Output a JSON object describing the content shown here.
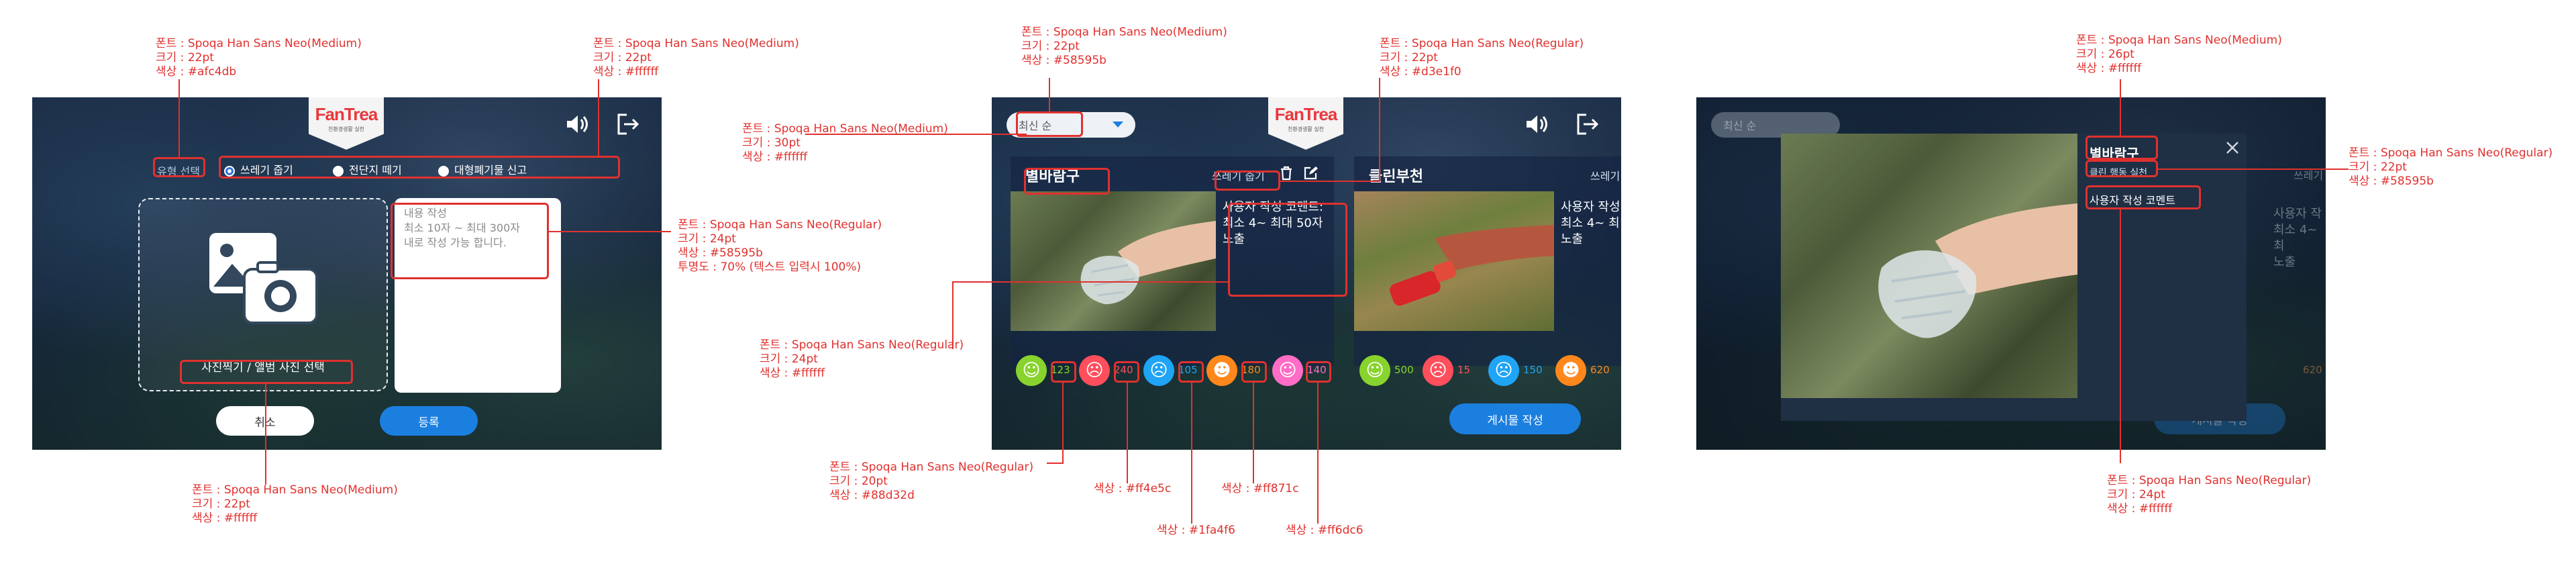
{
  "colors": {
    "annotation": "#e0312e",
    "type_select": "#afc4db",
    "white": "#ffffff",
    "placeholder": "#58595b",
    "gray_light": "#d3e1f0",
    "count_green": "#88d32d",
    "count_red": "#ff4e5c",
    "count_blue": "#1fa4f6",
    "count_orange": "#ff871c",
    "count_pink": "#ff6dc6",
    "submit_blue": "#1b7fe0"
  },
  "screen1": {
    "logo": "FanTrea",
    "logo_sub": "친환경생활 실천",
    "type_label": "유형 선택",
    "radios": [
      "쓰레기 줍기",
      "전단지 떼기",
      "대형폐기물 신고"
    ],
    "photo_label": "사진찍기 / 앨범 사진 선택",
    "textarea_lines": [
      "내용 작성",
      "최소 10자 ~ 최대 300자",
      "내로 작성 가능 합니다."
    ],
    "cancel": "취소",
    "submit": "등록",
    "icons": [
      "camera-gallery-icon",
      "speaker-icon",
      "logout-icon"
    ]
  },
  "screen2": {
    "sort_label": "최신 순",
    "card1": {
      "title": "별바람구",
      "category": "쓰레기 줍기",
      "comment": "사용자 작성 코멘트:\n최소 4~ 최대 50자\n노출",
      "counts": [
        "123",
        "240",
        "105",
        "180",
        "140"
      ]
    },
    "card2": {
      "title": "클린부천",
      "category": "쓰레기",
      "comment": "사용자 작성\n최소 4~ 최\n노출",
      "counts": [
        "500",
        "15",
        "150",
        "620"
      ]
    },
    "write_button": "게시물 작성"
  },
  "screen3": {
    "sort_label": "최신 순",
    "title": "별바람구",
    "subtitle": "클린 행동 실천",
    "comment": "사용자 작성 코멘트",
    "bg_right_label": "쓰레기",
    "bg_comment": "사용자 작\n최소 4~ 최\n노출",
    "bg_counts": [
      "620"
    ],
    "bg_button": "게시물 작성"
  },
  "annotations": {
    "a1": [
      "폰트 : Spoqa Han Sans Neo(Medium)",
      "크기 : 22pt",
      "색상 : #afc4db"
    ],
    "a2": [
      "폰트 : Spoqa Han Sans Neo(Medium)",
      "크기 : 22pt",
      "색상 : #ffffff"
    ],
    "a3": [
      "폰트 : Spoqa Han Sans Neo(Regular)",
      "크기 : 24pt",
      "색상 : #58595b",
      "투명도 : 70% (텍스트 입력시 100%)"
    ],
    "a4": [
      "폰트 : Spoqa Han Sans Neo(Medium)",
      "크기 : 22pt",
      "색상 : #ffffff"
    ],
    "b1": [
      "폰트 : Spoqa Han Sans Neo(Medium)",
      "크기 : 22pt",
      "색상 : #58595b"
    ],
    "b2": [
      "폰트 : Spoqa Han Sans Neo(Regular)",
      "크기 : 22pt",
      "색상 : #d3e1f0"
    ],
    "b3": [
      "폰트 : Spoqa Han Sans Neo(Medium)",
      "크기 : 30pt",
      "색상 : #ffffff"
    ],
    "b4": [
      "폰트 : Spoqa Han Sans Neo(Regular)",
      "크기 : 24pt",
      "색상 : #ffffff"
    ],
    "b5": [
      "폰트 : Spoqa Han Sans Neo(Regular)",
      "크기 : 20pt",
      "색상 : #88d32d"
    ],
    "b6": [
      "색상 : #ff4e5c"
    ],
    "b7": [
      "색상 : #1fa4f6"
    ],
    "b8": [
      "색상 : #ff871c"
    ],
    "b9": [
      "색상 : #ff6dc6"
    ],
    "c1": [
      "폰트 : Spoqa Han Sans Neo(Medium)",
      "크기 : 26pt",
      "색상 : #ffffff"
    ],
    "c2": [
      "폰트 : Spoqa Han Sans Neo(Regular)",
      "크기 : 22pt",
      "색상 : #58595b"
    ],
    "c3": [
      "폰트 : Spoqa Han Sans Neo(Regular)",
      "크기 : 24pt",
      "색상 : #ffffff"
    ]
  }
}
